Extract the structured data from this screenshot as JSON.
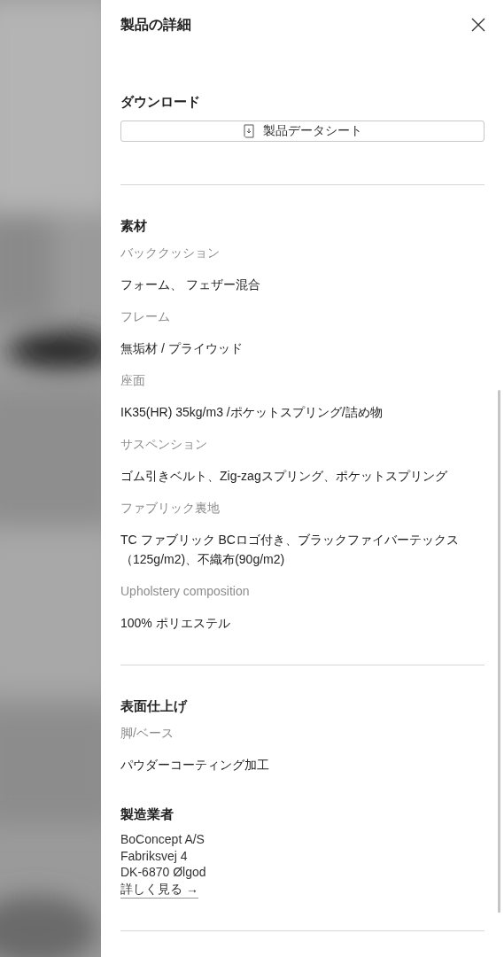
{
  "panel": {
    "title": "製品の詳細"
  },
  "sections": [
    {
      "kind": "download",
      "heading": "ダウンロード",
      "button": "製品データシート",
      "divider": true
    },
    {
      "kind": "specs",
      "heading": "素材",
      "divider": true,
      "items": [
        {
          "label": "バッククッション",
          "value": "フォーム、 フェザー混合"
        },
        {
          "label": "フレーム",
          "value": "無垢材 / プライウッド"
        },
        {
          "label": "座面",
          "value": "IK35(HR) 35kg/m3 /ポケットスプリング/詰め物"
        },
        {
          "label": "サスペンション",
          "value": "ゴム引きベルト、Zig-zagスプリング、ポケットスプリング"
        },
        {
          "label": "ファブリック裏地",
          "value": "TC ファブリック BCロゴ付き、ブラックファイバーテックス（125g/m2)、不織布(90g/m2)"
        },
        {
          "label": "Upholstery composition",
          "value": "100% ポリエステル"
        }
      ]
    },
    {
      "kind": "specs",
      "heading": "表面仕上げ",
      "divider": false,
      "items": [
        {
          "label": "脚/ベース",
          "value": "パウダーコーティング加工"
        }
      ]
    },
    {
      "kind": "address",
      "heading": "製造業者",
      "divider": true,
      "lines": [
        "BoConcept A/S",
        "Fabriksvej 4",
        "DK-6870 Ølgod"
      ],
      "link": "詳しく見る →"
    }
  ]
}
